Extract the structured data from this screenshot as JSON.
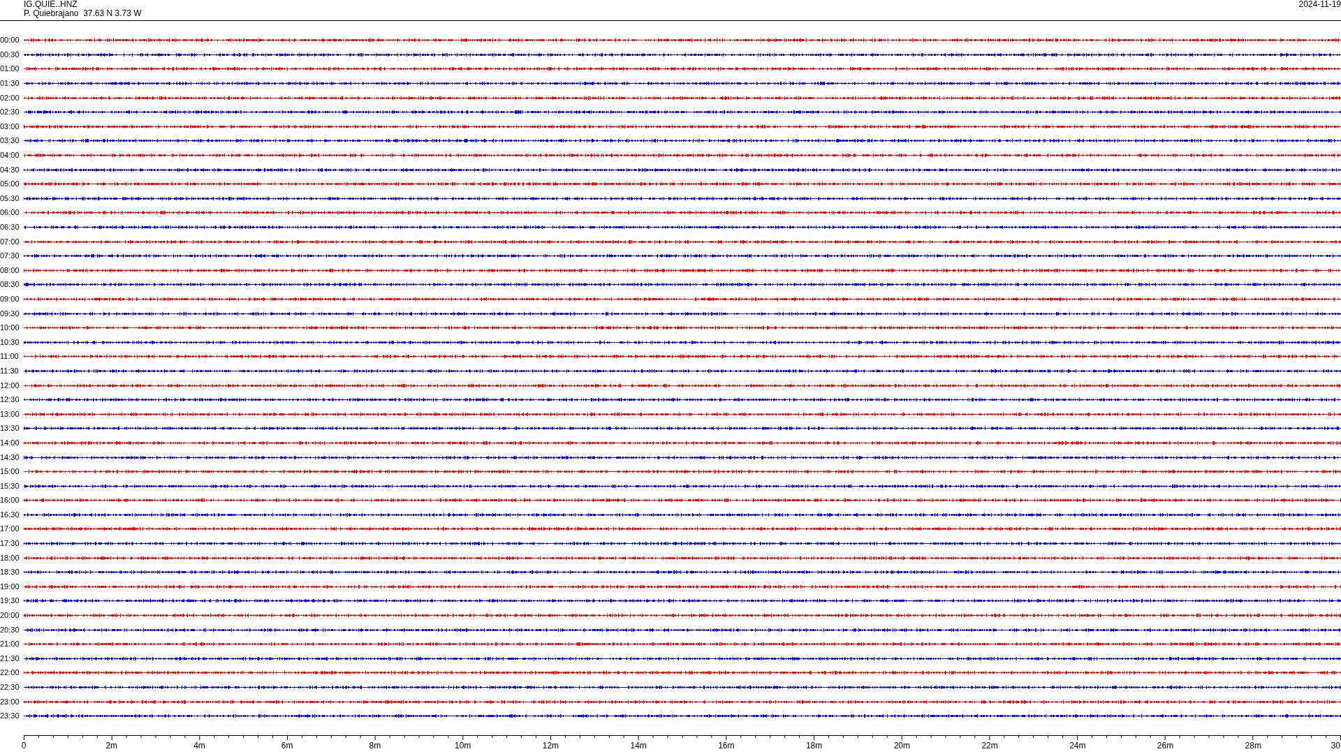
{
  "header": {
    "station": "IG.QUIE..HNZ",
    "location": "P. Quiebrajano  37.63 N 3.73 W",
    "date": "2024-11-19"
  },
  "traces": [
    {
      "time": "00:00",
      "color": "#ff0000"
    },
    {
      "time": "00:30",
      "color": "#0000ff"
    },
    {
      "time": "01:00",
      "color": "#ff0000"
    },
    {
      "time": "01:30",
      "color": "#0000ff"
    },
    {
      "time": "02:00",
      "color": "#ff0000"
    },
    {
      "time": "02:30",
      "color": "#0000ff"
    },
    {
      "time": "03:00",
      "color": "#ff0000"
    },
    {
      "time": "03:30",
      "color": "#0000ff"
    },
    {
      "time": "04:00",
      "color": "#ff0000"
    },
    {
      "time": "04:30",
      "color": "#0000ff"
    },
    {
      "time": "05:00",
      "color": "#ff0000"
    },
    {
      "time": "05:30",
      "color": "#0000ff"
    },
    {
      "time": "06:00",
      "color": "#ff0000"
    },
    {
      "time": "06:30",
      "color": "#0000ff"
    },
    {
      "time": "07:00",
      "color": "#ff0000"
    },
    {
      "time": "07:30",
      "color": "#0000ff"
    },
    {
      "time": "08:00",
      "color": "#ff0000"
    },
    {
      "time": "08:30",
      "color": "#0000ff"
    },
    {
      "time": "09:00",
      "color": "#ff0000"
    },
    {
      "time": "09:30",
      "color": "#0000ff"
    },
    {
      "time": "10:00",
      "color": "#ff0000"
    },
    {
      "time": "10:30",
      "color": "#0000ff"
    },
    {
      "time": "11:00",
      "color": "#ff0000"
    },
    {
      "time": "11:30",
      "color": "#0000ff"
    },
    {
      "time": "12:00",
      "color": "#ff0000"
    },
    {
      "time": "12:30",
      "color": "#0000ff"
    },
    {
      "time": "13:00",
      "color": "#ff0000"
    },
    {
      "time": "13:30",
      "color": "#0000ff"
    },
    {
      "time": "14:00",
      "color": "#ff0000"
    },
    {
      "time": "14:30",
      "color": "#0000ff"
    },
    {
      "time": "15:00",
      "color": "#ff0000"
    },
    {
      "time": "15:30",
      "color": "#0000ff"
    },
    {
      "time": "16:00",
      "color": "#ff0000"
    },
    {
      "time": "16:30",
      "color": "#0000ff"
    },
    {
      "time": "17:00",
      "color": "#ff0000"
    },
    {
      "time": "17:30",
      "color": "#0000ff"
    },
    {
      "time": "18:00",
      "color": "#ff0000"
    },
    {
      "time": "18:30",
      "color": "#0000ff"
    },
    {
      "time": "19:00",
      "color": "#ff0000"
    },
    {
      "time": "19:30",
      "color": "#0000ff"
    },
    {
      "time": "20:00",
      "color": "#ff0000"
    },
    {
      "time": "20:30",
      "color": "#0000ff"
    },
    {
      "time": "21:00",
      "color": "#ff0000"
    },
    {
      "time": "21:30",
      "color": "#0000ff"
    },
    {
      "time": "22:00",
      "color": "#ff0000"
    },
    {
      "time": "22:30",
      "color": "#0000ff"
    },
    {
      "time": "23:00",
      "color": "#ff0000"
    },
    {
      "time": "23:30",
      "color": "#0000ff"
    }
  ],
  "time_axis": {
    "labels": [
      "0",
      "2m",
      "4m",
      "6m",
      "8m",
      "10m",
      "12m",
      "14m",
      "16m",
      "18m",
      "20m",
      "22m",
      "24m",
      "26m",
      "28m",
      "30"
    ]
  }
}
